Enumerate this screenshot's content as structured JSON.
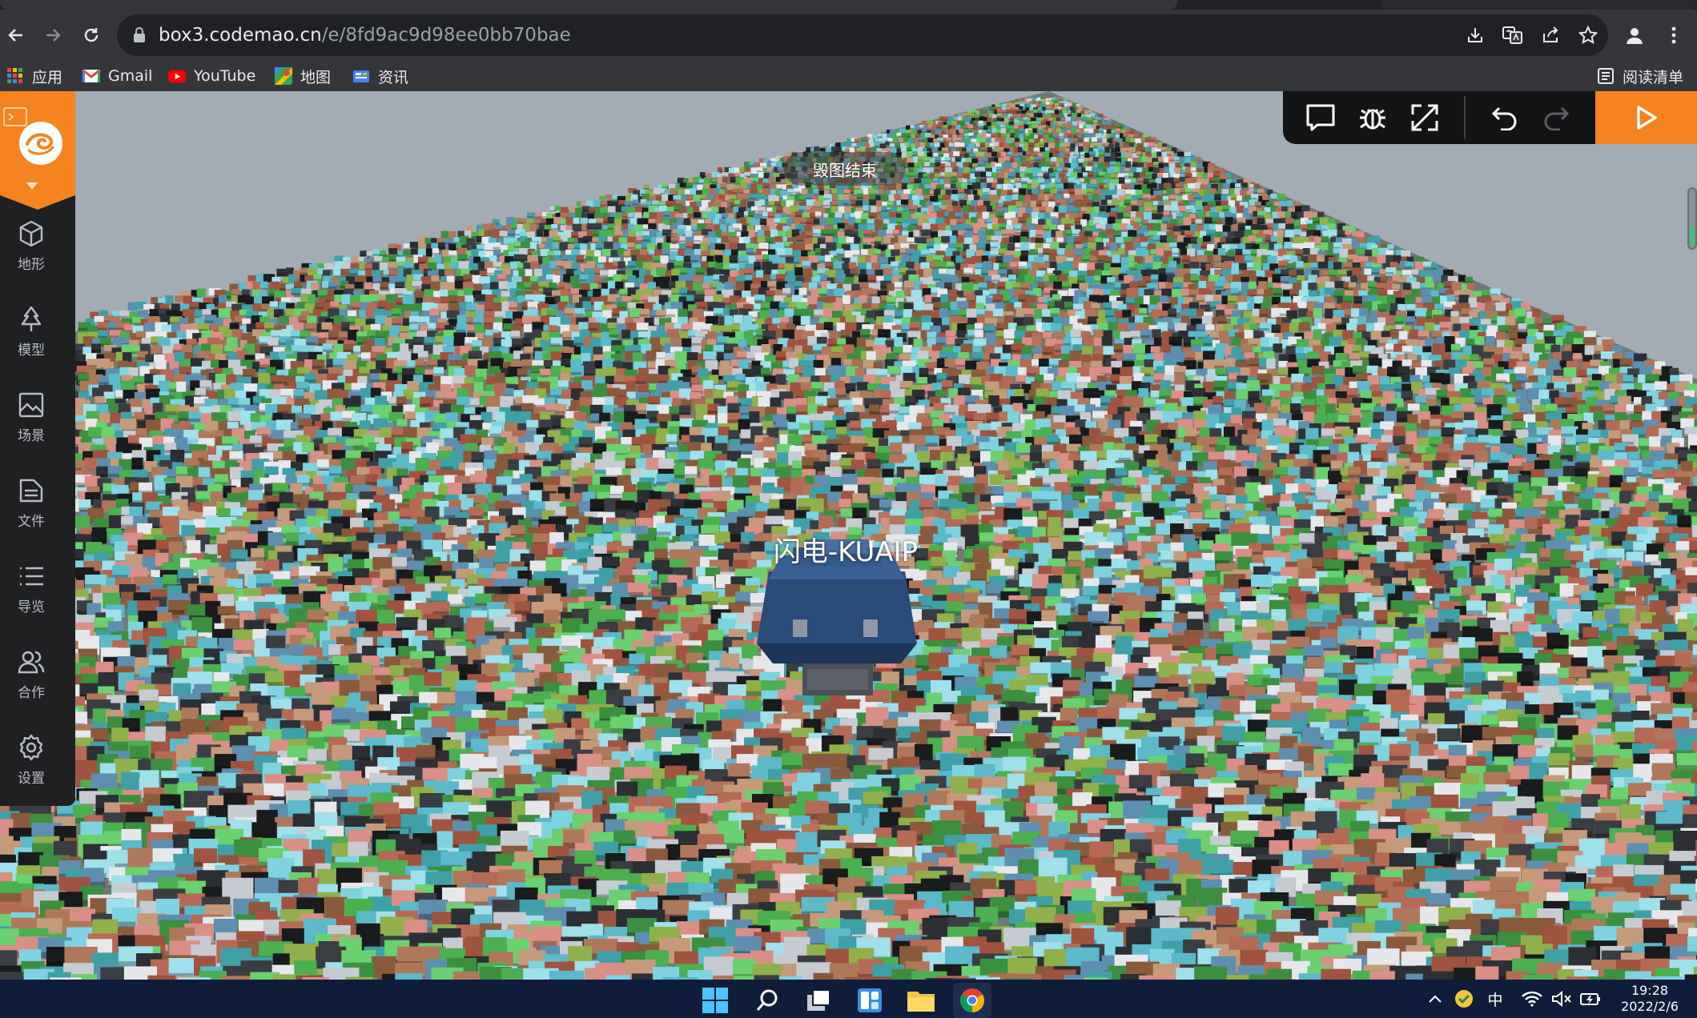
{
  "browser": {
    "url_host": "box3.codemao.cn",
    "url_path": "/e/8fd9ac9d98ee0bb70bae",
    "icons": [
      "back-arrow-icon",
      "forward-arrow-icon",
      "reload-icon",
      "lock-icon",
      "install-app-icon",
      "translate-icon",
      "share-icon",
      "bookmark-star-icon",
      "profile-icon",
      "menu-dots-icon"
    ]
  },
  "bookmarks": {
    "items": [
      {
        "label": "应用",
        "icon": "apps-grid-icon"
      },
      {
        "label": "Gmail",
        "icon": "gmail-icon"
      },
      {
        "label": "YouTube",
        "icon": "youtube-icon"
      },
      {
        "label": "地图",
        "icon": "maps-icon"
      },
      {
        "label": "资讯",
        "icon": "news-icon"
      }
    ],
    "reading_list": "阅读清单"
  },
  "editor": {
    "sidebar": [
      {
        "label": "地形",
        "icon": "cube-icon"
      },
      {
        "label": "模型",
        "icon": "tree-icon"
      },
      {
        "label": "场景",
        "icon": "image-icon"
      },
      {
        "label": "文件",
        "icon": "file-icon"
      },
      {
        "label": "导览",
        "icon": "list-icon"
      },
      {
        "label": "合作",
        "icon": "users-icon"
      },
      {
        "label": "设置",
        "icon": "gear-icon"
      }
    ],
    "toolbar_icons": [
      "chat-icon",
      "bug-icon",
      "fullscreen-icon",
      "undo-icon",
      "redo-icon",
      "play-icon"
    ],
    "toast": "毁图结束",
    "player_label": "闪电-KUAIP"
  },
  "taskbar": {
    "tray_ime": "中",
    "clock_time": "19:28",
    "clock_date": "2022/2/6"
  },
  "colors": {
    "accent": "#f5831f",
    "sidebar_bg": "#1f2021",
    "toolbar_bg": "#131415",
    "sky": "#a3abb5",
    "taskbar": "#0f1c3a"
  }
}
